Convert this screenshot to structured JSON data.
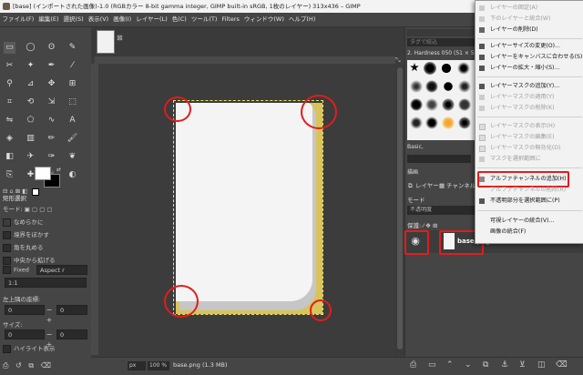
{
  "window": {
    "title": "[base] (インポートされた画像)-1.0 (RGBカラー 8-bit gamma integer, GIMP built-in sRGB, 1枚のレイヤー) 313x436 – GIMP"
  },
  "menubar": [
    "ファイル(F)",
    "編集(E)",
    "選択(S)",
    "表示(V)",
    "画像(I)",
    "レイヤー(L)",
    "色(C)",
    "ツール(T)",
    "Filters",
    "ウィンドウ(W)",
    "ヘルプ(H)"
  ],
  "tool_options": {
    "title": "矩形選択",
    "mode_label": "モード:",
    "antialias": "なめらかに",
    "feather": "境界をぼかす",
    "rounded": "角を丸める",
    "expand_center": "中央から拡げる",
    "fixed_label": "Fixed",
    "fixed_value": "Aspect r",
    "ratio": "1:1",
    "position_label": "左上隅の座標:",
    "pos_x": "0",
    "pos_y": "0",
    "size_label": "サイズ:",
    "size_w": "0",
    "size_h": "0",
    "highlight": "ハイライト表示"
  },
  "canvas": {
    "unit": "px",
    "zoom": "100 %",
    "status": "base.png (1.3 MB)"
  },
  "brushes": {
    "filter_placeholder": "タグで絞込",
    "current": "2. Hardness 050 (51 × 51)",
    "preset_label": "Basic,",
    "edit_label": "描画"
  },
  "layers": {
    "tabs": [
      "レイヤー",
      "チャンネル"
    ],
    "mode_label": "モード",
    "opacity_label": "不透明度",
    "lock_label": "保護:",
    "layer_name": "base.png"
  },
  "context_menu": {
    "items": [
      {
        "label": "レイヤーの固定(A)",
        "enabled": false
      },
      {
        "label": "下のレイヤーと統合(W)",
        "enabled": false
      },
      {
        "label": "レイヤーの削除(D)",
        "enabled": true
      },
      {
        "label": "レイヤーサイズの変更(O)...",
        "enabled": true
      },
      {
        "label": "レイヤーをキャンバスに合わせる(S)",
        "enabled": true
      },
      {
        "label": "レイヤーの拡大・縮小(S)...",
        "enabled": true
      },
      {
        "label": "レイヤーマスクの追加(Y)...",
        "enabled": true
      },
      {
        "label": "レイヤーマスクの適用(Y)",
        "enabled": false
      },
      {
        "label": "レイヤーマスクの削除(K)",
        "enabled": false
      },
      {
        "label": "レイヤーマスクの表示(H)",
        "enabled": false
      },
      {
        "label": "レイヤーマスクの編集(E)",
        "enabled": false
      },
      {
        "label": "レイヤーマスクの無効化(D)",
        "enabled": false
      },
      {
        "label": "マスクを選択範囲に",
        "enabled": false
      },
      {
        "label": "アルファチャンネルの追加(H)",
        "enabled": true
      },
      {
        "label": "アルファチャンネルの削除(R)",
        "enabled": false
      },
      {
        "label": "不透明部分を選択範囲に(P)",
        "enabled": true
      },
      {
        "label": "可視レイヤーの統合(V)...",
        "enabled": true
      },
      {
        "label": "画像の統合(F)",
        "enabled": true
      }
    ]
  },
  "colors": {
    "highlight": "#e31c1c",
    "panel": "#454545",
    "canvas_bg": "#3c3c3c",
    "menu_bg": "#f2f2f2"
  }
}
